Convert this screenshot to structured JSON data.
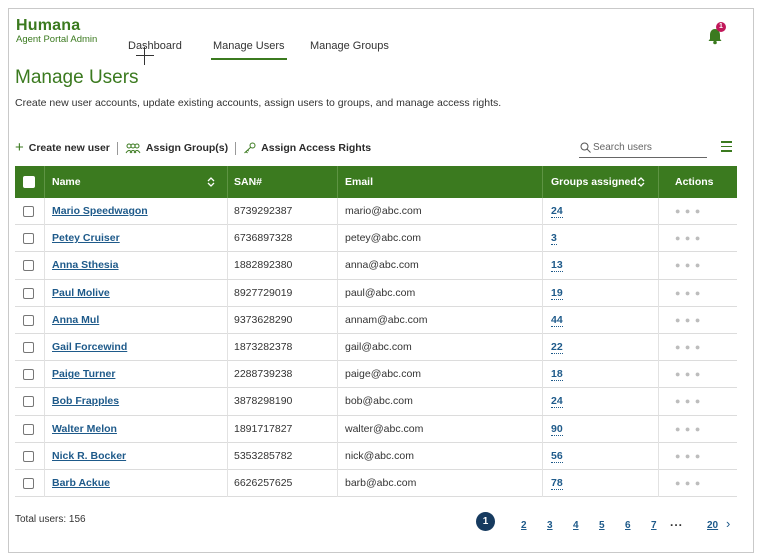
{
  "header": {
    "brand": "Humana",
    "subtitle": "Agent Portal Admin",
    "nav": [
      "Dashboard",
      "Manage Users",
      "Manage Groups"
    ],
    "active_nav": "Manage Users",
    "notification_count": "1"
  },
  "page": {
    "title": "Manage Users",
    "description": "Create new user accounts, update existing accounts, assign users to groups, and manage access rights."
  },
  "toolbar": {
    "create_label": "Create new user",
    "assign_groups_label": "Assign Group(s)",
    "assign_access_label": "Assign Access Rights",
    "search_placeholder": "Search users"
  },
  "table": {
    "columns": [
      "Name",
      "SAN#",
      "Email",
      "Groups assigned",
      "Actions"
    ],
    "rows": [
      {
        "name": "Mario Speedwagon",
        "san": "8739292387",
        "email": "mario@abc.com",
        "groups": "24"
      },
      {
        "name": "Petey Cruiser",
        "san": "6736897328",
        "email": "petey@abc.com",
        "groups": "3"
      },
      {
        "name": "Anna Sthesia",
        "san": "1882892380",
        "email": "anna@abc.com",
        "groups": "13"
      },
      {
        "name": "Paul Molive",
        "san": "8927729019",
        "email": "paul@abc.com",
        "groups": "19"
      },
      {
        "name": "Anna Mul",
        "san": "9373628290",
        "email": "annam@abc.com",
        "groups": "44"
      },
      {
        "name": "Gail Forcewind",
        "san": "1873282378",
        "email": "gail@abc.com",
        "groups": "22"
      },
      {
        "name": "Paige Turner",
        "san": "2288739238",
        "email": "paige@abc.com",
        "groups": "18"
      },
      {
        "name": "Bob Frapples",
        "san": "3878298190",
        "email": "bob@abc.com",
        "groups": "24"
      },
      {
        "name": "Walter Melon",
        "san": "1891717827",
        "email": "walter@abc.com",
        "groups": "90"
      },
      {
        "name": "Nick R. Bocker",
        "san": "5353285782",
        "email": "nick@abc.com",
        "groups": "56"
      },
      {
        "name": "Barb Ackue",
        "san": "6626257625",
        "email": "barb@abc.com",
        "groups": "78"
      }
    ],
    "actions_glyph": "● ● ●"
  },
  "footer": {
    "total": "Total users: 156",
    "pages": [
      "1",
      "2",
      "3",
      "4",
      "5",
      "6",
      "7"
    ],
    "current_page": "1",
    "ellipsis": "...",
    "last_page": "20",
    "next_glyph": "›"
  },
  "colors": {
    "brand_green": "#3b7a1f",
    "link_blue": "#1e5a8a",
    "badge_magenta": "#c1175a",
    "pager_navy": "#163a5f"
  }
}
